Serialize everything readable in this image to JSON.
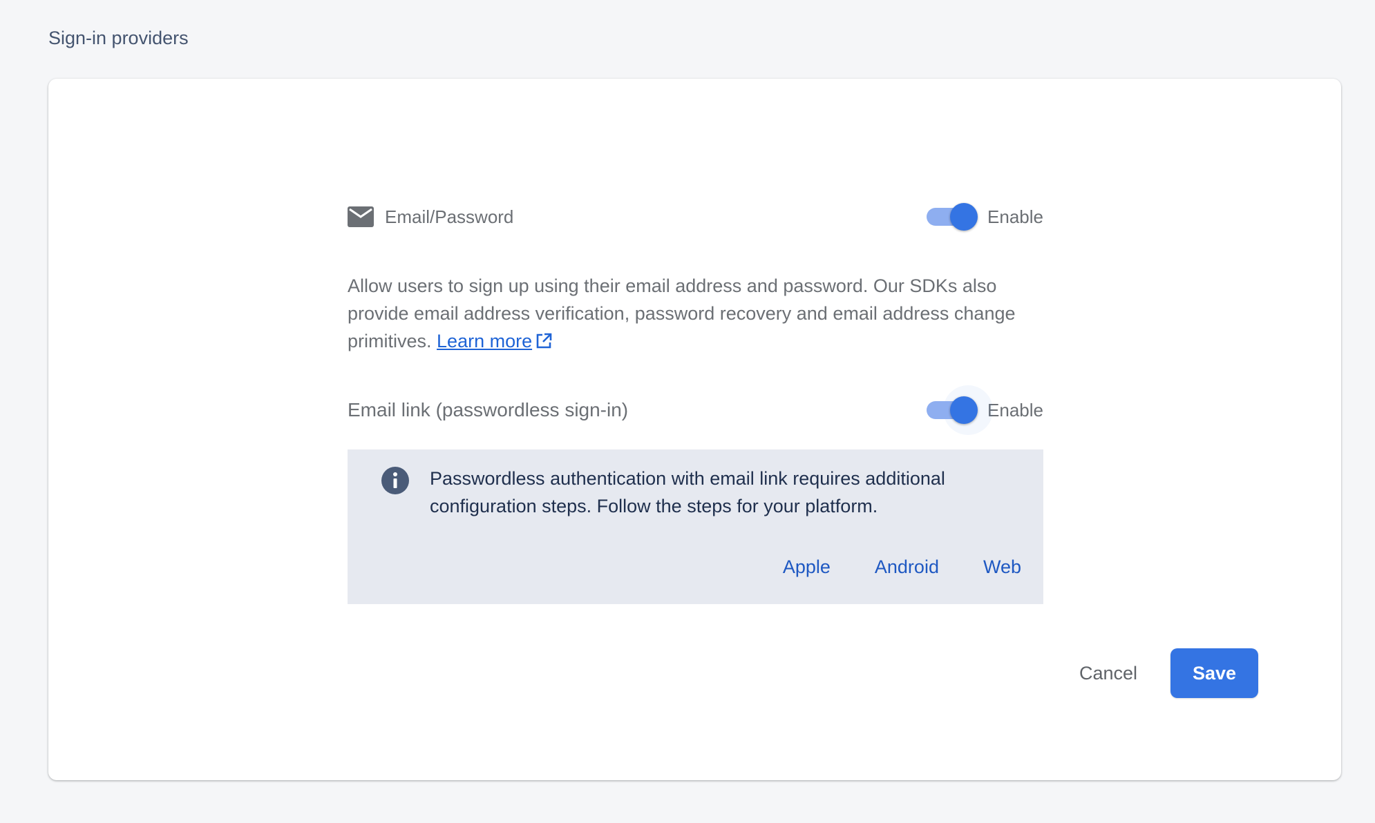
{
  "section": {
    "title": "Sign-in providers"
  },
  "provider": {
    "name": "Email/Password",
    "icon": "mail-icon",
    "enabled": true,
    "toggle_label": "Enable",
    "description": "Allow users to sign up using their email address and password. Our SDKs also provide email address verification, password recovery and email address change primitives.",
    "learn_more": "Learn more"
  },
  "email_link": {
    "name": "Email link (passwordless sign-in)",
    "enabled": true,
    "toggle_label": "Enable"
  },
  "info": {
    "icon": "info-icon",
    "text": "Passwordless authentication with email link requires additional configuration steps. Follow the steps for your platform.",
    "platforms": [
      "Apple",
      "Android",
      "Web"
    ]
  },
  "actions": {
    "cancel_label": "Cancel",
    "save_label": "Save"
  },
  "colors": {
    "accent": "#3474e3",
    "link": "#1e63d6",
    "info_background": "#e6e9f0"
  }
}
